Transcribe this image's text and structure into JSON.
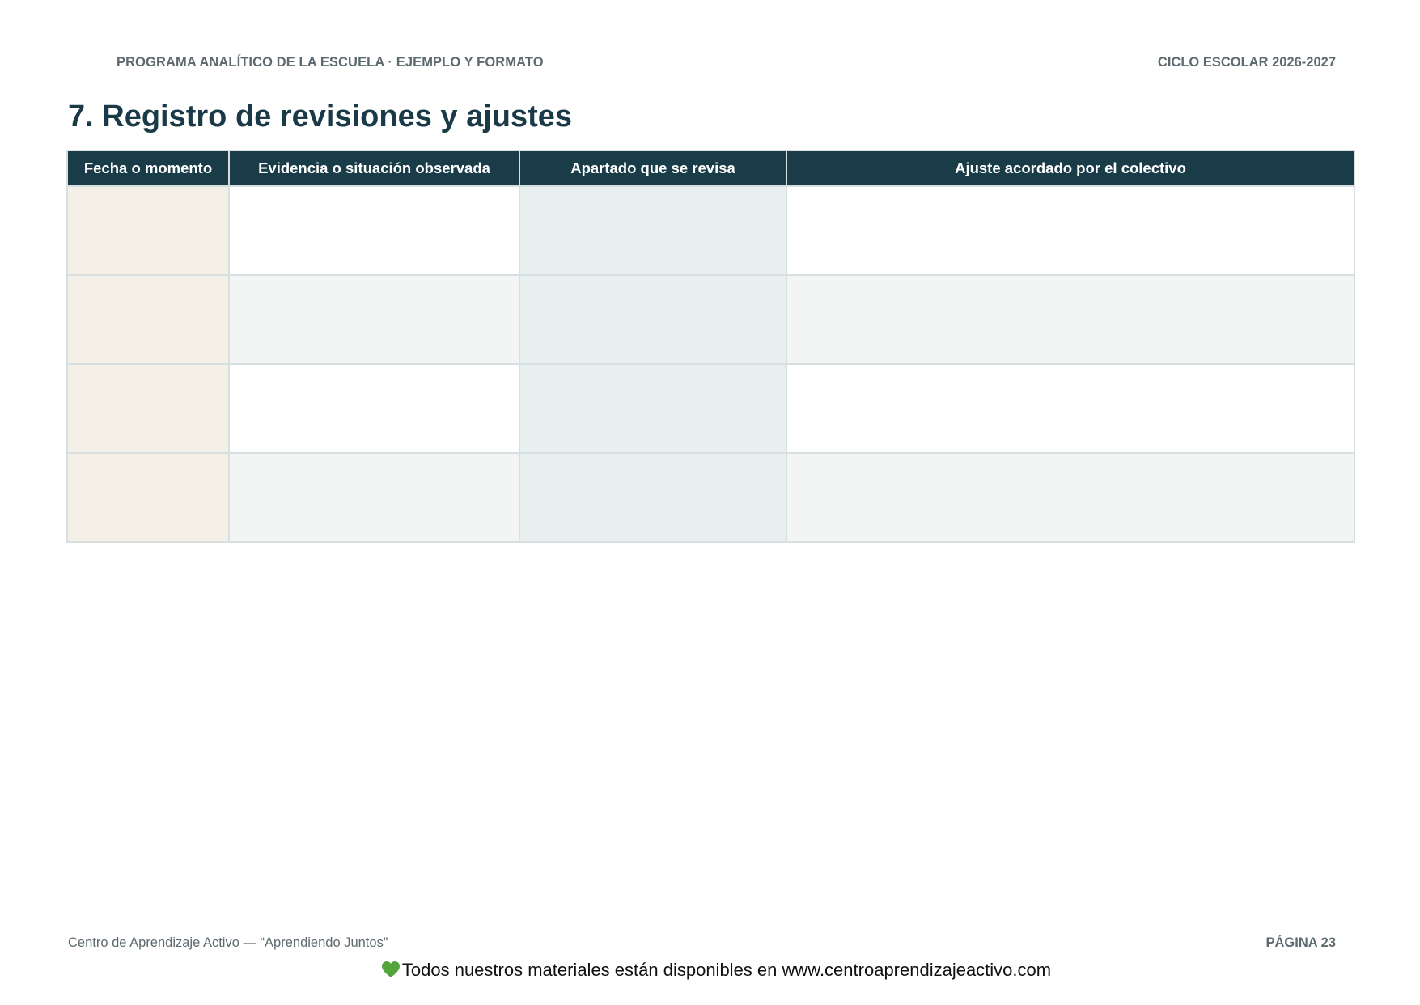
{
  "header": {
    "left_text": "PROGRAMA ANALÍTICO DE LA ESCUELA · EJEMPLO Y FORMATO",
    "right_text": "CICLO ESCOLAR 2026-2027"
  },
  "page_title": "7. Registro de revisiones y ajustes",
  "table": {
    "columns": [
      "Fecha o momento",
      "Evidencia o situación observada",
      "Apartado que se revisa",
      "Ajuste acordado por el colectivo"
    ],
    "rows": [
      [
        "",
        "",
        "",
        ""
      ],
      [
        "",
        "",
        "",
        ""
      ],
      [
        "",
        "",
        "",
        ""
      ],
      [
        "",
        "",
        "",
        ""
      ]
    ]
  },
  "footer": {
    "left_text": "Centro de Aprendizaje Activo — “Aprendiendo Juntos”",
    "page_label": "PÁGINA 23",
    "note": "Todos nuestros materiales están disponibles en www.centroaprendizajeactivo.com",
    "note_icon": "green-heart-icon"
  },
  "colors": {
    "header_bg": "#193c48",
    "title": "#193a46",
    "date_column_bg": "#f4f0e8",
    "section_column_bg": "#e8f0ef",
    "heart": "#55a33b"
  }
}
